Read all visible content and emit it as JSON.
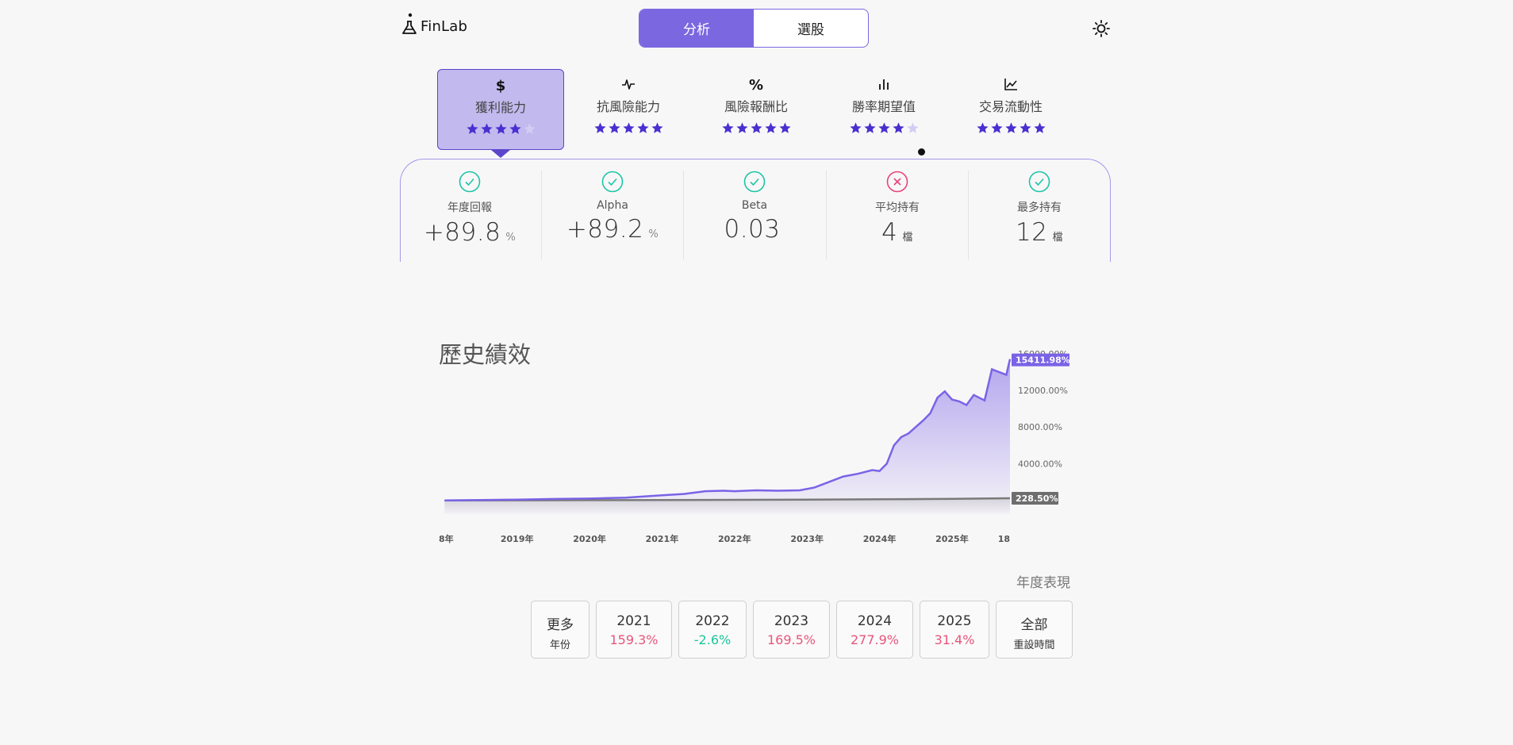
{
  "header": {
    "logo_text": "FinLab",
    "tabs": [
      {
        "label": "分析",
        "active": true
      },
      {
        "label": "選股",
        "active": false
      }
    ],
    "theme_icon": "sun-icon"
  },
  "categories": [
    {
      "icon": "dollar-icon",
      "label": "獲利能力",
      "rating": 4,
      "active": true
    },
    {
      "icon": "pulse-icon",
      "label": "抗風險能力",
      "rating": 5,
      "active": false
    },
    {
      "icon": "percent-icon",
      "label": "風險報酬比",
      "rating": 5,
      "active": false
    },
    {
      "icon": "bar-chart-icon",
      "label": "勝率期望值",
      "rating": 4,
      "active": false
    },
    {
      "icon": "line-chart-icon",
      "label": "交易流動性",
      "rating": 5,
      "active": false
    }
  ],
  "metrics": [
    {
      "label": "年度回報",
      "value": "+89.8",
      "unit": "%",
      "status": "pass"
    },
    {
      "label": "Alpha",
      "value": "+89.2",
      "unit": "%",
      "status": "pass"
    },
    {
      "label": "Beta",
      "value": "0.03",
      "unit": "",
      "status": "pass"
    },
    {
      "label": "平均持有",
      "value": "4",
      "unit": "檔",
      "status": "fail"
    },
    {
      "label": "最多持有",
      "value": "12",
      "unit": "檔",
      "status": "pass"
    }
  ],
  "colors": {
    "accent": "#7b67e0",
    "strategy_line": "#7a63e6",
    "benchmark_line": "#7a7a7a",
    "pass": "#1cc5a7",
    "fail": "#e8437b",
    "positive": "#e8557b",
    "negative": "#1cc59a"
  },
  "chart_data": {
    "type": "area",
    "title": "歷史績效",
    "x_tick_labels": [
      "8年",
      "2019年",
      "2020年",
      "2021年",
      "2022年",
      "2023年",
      "2024年",
      "2025年",
      "18"
    ],
    "y_tick_labels": [
      "16000.00%",
      "12000.00%",
      "8000.00%",
      "4000.00%"
    ],
    "ylim": [
      -1500,
      16500
    ],
    "y_ticks": [
      16000,
      12000,
      8000,
      4000
    ],
    "series": [
      {
        "role": "strategy",
        "last_label": "15411.98%",
        "x": [
          2018.0,
          2018.5,
          2019.0,
          2019.5,
          2020.0,
          2020.5,
          2021.0,
          2021.3,
          2021.6,
          2021.85,
          2022.0,
          2022.3,
          2022.6,
          2022.9,
          2023.1,
          2023.3,
          2023.5,
          2023.7,
          2023.9,
          2024.0,
          2024.1,
          2024.2,
          2024.3,
          2024.4,
          2024.5,
          2024.6,
          2024.7,
          2024.8,
          2024.9,
          2025.0,
          2025.1,
          2025.2,
          2025.3,
          2025.45,
          2025.55,
          2025.65,
          2025.75,
          2025.8
        ],
        "values": [
          0,
          30,
          80,
          150,
          200,
          300,
          550,
          700,
          1000,
          1050,
          1000,
          1100,
          1050,
          1100,
          1400,
          2000,
          2600,
          2900,
          3300,
          3200,
          4000,
          6000,
          6900,
          7300,
          8000,
          8700,
          9500,
          11200,
          11900,
          11000,
          10800,
          10400,
          11500,
          10900,
          14300,
          14000,
          13700,
          15412
        ]
      },
      {
        "role": "benchmark",
        "last_label": "228.50%",
        "x": [
          2018.0,
          2019.0,
          2020.0,
          2021.0,
          2022.0,
          2023.0,
          2024.0,
          2025.0,
          2025.8
        ],
        "values": [
          0,
          10,
          20,
          40,
          60,
          80,
          120,
          170,
          228.5
        ]
      }
    ]
  },
  "yearly": {
    "title": "年度表現",
    "more": {
      "line1": "更多",
      "line2": "年份"
    },
    "years": [
      {
        "year": "2021",
        "value": "159.3%",
        "sign": "pos"
      },
      {
        "year": "2022",
        "value": "-2.6%",
        "sign": "neg"
      },
      {
        "year": "2023",
        "value": "169.5%",
        "sign": "pos"
      },
      {
        "year": "2024",
        "value": "277.9%",
        "sign": "pos"
      },
      {
        "year": "2025",
        "value": "31.4%",
        "sign": "pos"
      }
    ],
    "reset": {
      "line1": "全部",
      "line2": "重設時間"
    }
  }
}
